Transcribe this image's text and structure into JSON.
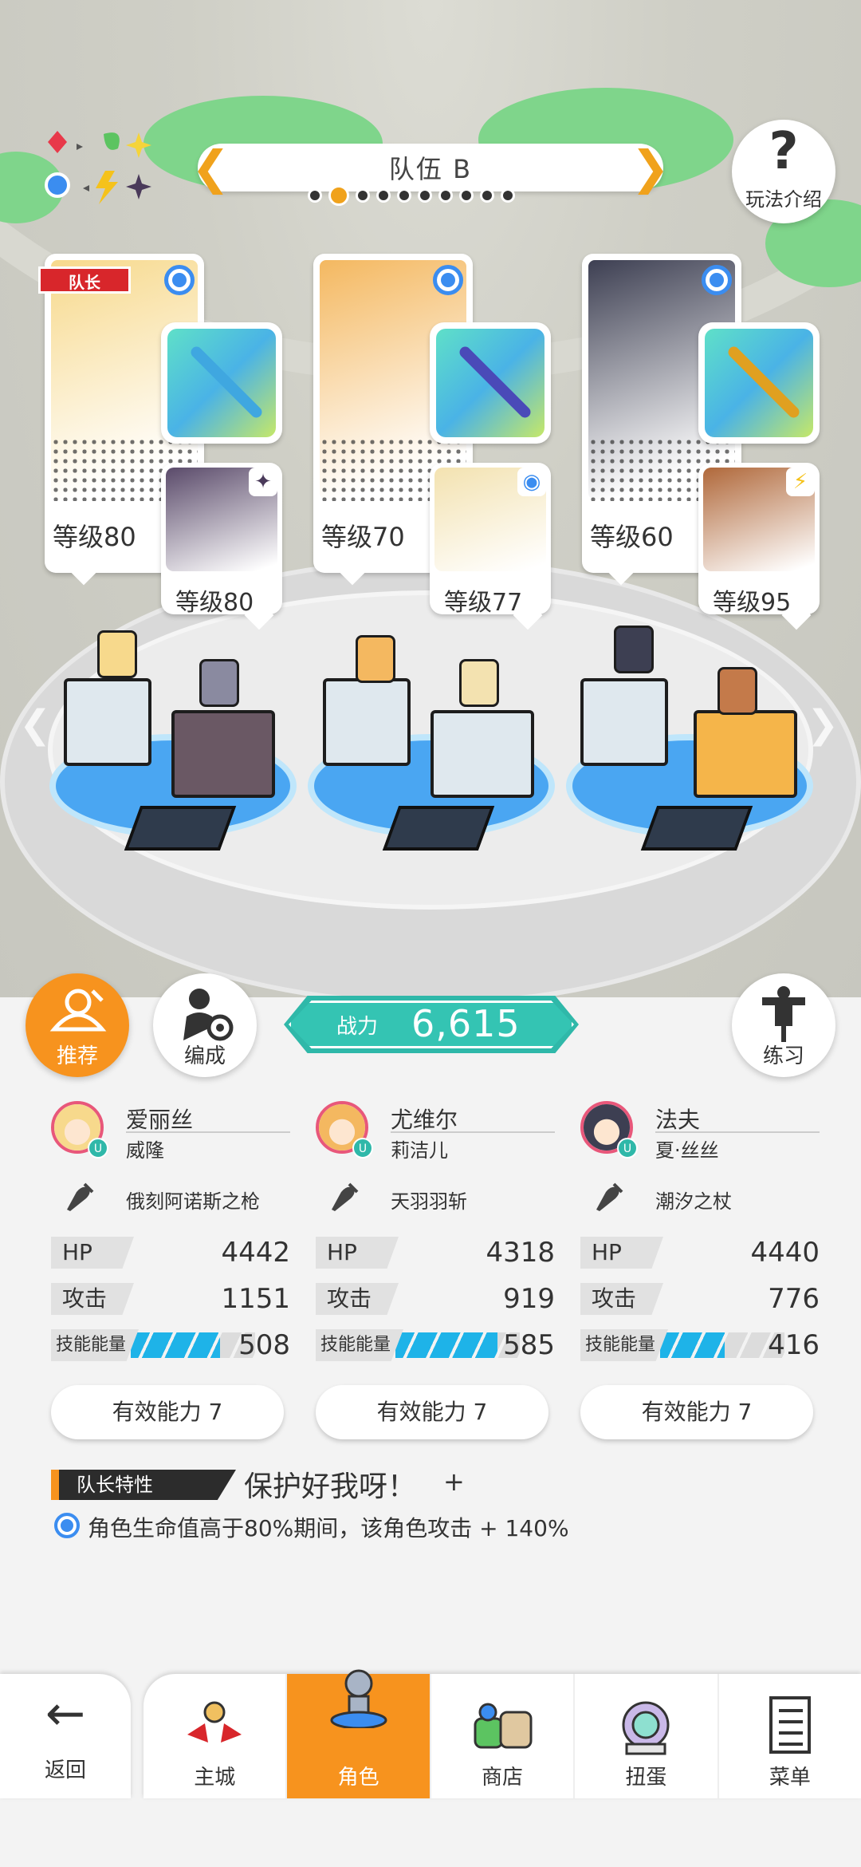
{
  "header": {
    "team_title": "队伍 B",
    "team_count": 10,
    "active_team_index": 1,
    "help_label": "玩法介绍"
  },
  "leader_label": "队长",
  "characters": [
    {
      "level": "等级80",
      "element_color": "#3b8df0",
      "is_leader": true,
      "portrait_color": "#f7d98c",
      "weapon_color": "#3fa7e0",
      "support": {
        "level": "等级80",
        "element": "dark",
        "element_glyph": "✦",
        "element_color": "#4a3a5a",
        "art_color": "#5a4a6a"
      }
    },
    {
      "level": "等级70",
      "element_color": "#3b8df0",
      "is_leader": false,
      "portrait_color": "#f4b860",
      "weapon_color": "#4a4ab8",
      "support": {
        "level": "等级77",
        "element": "water",
        "element_glyph": "◉",
        "element_color": "#3b8df0",
        "art_color": "#f3e2b0"
      }
    },
    {
      "level": "等级60",
      "element_color": "#3b8df0",
      "is_leader": false,
      "portrait_color": "#3d3f52",
      "weapon_color": "#e0a020",
      "support": {
        "level": "等级95",
        "element": "thunder",
        "element_glyph": "⚡",
        "element_color": "#f5c21b",
        "art_color": "#b0683a"
      }
    }
  ],
  "actions": {
    "recommend_label": "推荐",
    "formation_label": "编成",
    "power_label": "战力",
    "power_value": "6,615",
    "practice_label": "练习"
  },
  "stats": [
    {
      "name": "爱丽丝",
      "subname": "威隆",
      "weapon": "俄刻阿诺斯之枪",
      "hp_label": "HP",
      "hp": "4442",
      "atk_label": "攻击",
      "atk": "1151",
      "energy_label": "技能能量",
      "energy": "508",
      "energy_fill": 0.72,
      "effective": "有效能力 7",
      "avatar_color": "#f7d98c"
    },
    {
      "name": "尤维尔",
      "subname": "莉洁儿",
      "weapon": "天羽羽斩",
      "hp_label": "HP",
      "hp": "4318",
      "atk_label": "攻击",
      "atk": "919",
      "energy_label": "技能能量",
      "energy": "585",
      "energy_fill": 0.82,
      "effective": "有效能力 7",
      "avatar_color": "#f4b860"
    },
    {
      "name": "法夫",
      "subname": "夏·丝丝",
      "weapon": "潮汐之杖",
      "hp_label": "HP",
      "hp": "4440",
      "atk_label": "攻击",
      "atk": "776",
      "energy_label": "技能能量",
      "energy": "416",
      "energy_fill": 0.52,
      "effective": "有效能力 7",
      "avatar_color": "#3d3f52"
    }
  ],
  "leader_trait": {
    "tag": "队长特性",
    "name": "保护好我呀！",
    "plus": "+",
    "description": "角色生命值高于80%期间，该角色攻击 + 140%"
  },
  "nav": {
    "back": "返回",
    "tabs": [
      {
        "label": "主城",
        "icon": "castle-icon",
        "active": false
      },
      {
        "label": "角色",
        "icon": "character-icon",
        "active": true
      },
      {
        "label": "商店",
        "icon": "shop-icon",
        "active": false
      },
      {
        "label": "扭蛋",
        "icon": "gacha-icon",
        "active": false
      },
      {
        "label": "菜单",
        "icon": "menu-icon",
        "active": false
      }
    ]
  },
  "colors": {
    "accent_orange": "#f7931e",
    "teal": "#2fb8a9",
    "energy_blue": "#1eb3e8",
    "element_blue": "#3b8df0"
  }
}
